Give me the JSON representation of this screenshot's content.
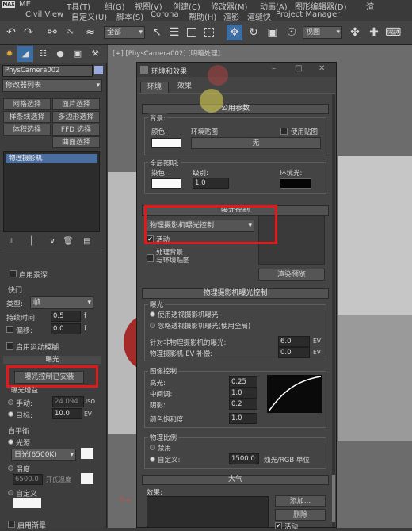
{
  "app": {
    "logo": "MAX"
  },
  "menubar": {
    "row1": [
      "ME",
      "T具(T)",
      "组(G)",
      "视图(V)",
      "创建(C)",
      "修改器(M)",
      "动画(A)",
      "图形编辑器(D)",
      "渲"
    ],
    "row2": [
      "Civil View",
      "自定义(U)",
      "脚本(S)",
      "Corona",
      "帮助(H)",
      "渲影",
      "渲缝快",
      "Project Manager"
    ]
  },
  "toolbar": {
    "selection_filter": "全部",
    "view_dropdown": "视图",
    "undo_icon": "undo-icon",
    "redo_icon": "redo-icon"
  },
  "left_panel": {
    "object_name": "PhysCamera002",
    "modifier_list": "修改器列表",
    "buttons": [
      "网格选择",
      "面片选择",
      "样条线选择",
      "多边形选择",
      "体积选择",
      "FFD 选择",
      "",
      "曲面选择"
    ],
    "stack_item": "物理摄影机",
    "enable_dof": "启用景深",
    "shutter": {
      "title": "快门",
      "type_label": "类型:",
      "type_value": "帧",
      "duration_label": "持续时间:",
      "duration_value": "0.5",
      "duration_unit": "f",
      "offset_label": "偏移:",
      "offset_value": "0.0",
      "offset_unit": "f",
      "motion_blur": "启用运动模糊"
    },
    "exposure": {
      "title": "曝光",
      "installed_btn": "曝光控制已安装",
      "gain_label": "曝光增益",
      "manual": "手动:",
      "manual_value": "24.094",
      "manual_unit": "ISO",
      "target": "目标:",
      "target_value": "10.0",
      "target_unit": "EV"
    },
    "white_balance": {
      "title": "白平衡",
      "light_source": "光源",
      "daylight": "日光(6500K)",
      "temperature": "温度",
      "temp_value": "6500.0",
      "temp_unit": "开氏温度",
      "custom": "自定义",
      "vignette": "启用渐晕"
    }
  },
  "viewport": {
    "label": "[+] [PhysCamera002] [明暗处理]"
  },
  "dialog": {
    "title": "环境和效果",
    "tabs": [
      "环境",
      "效果"
    ],
    "common_params": {
      "header": "公用参数",
      "background": "背景:",
      "color_label": "颜色:",
      "env_map_label": "环境贴图:",
      "use_map": "使用贴图",
      "map_value": "无",
      "global_lighting": "全局照明:",
      "tint_label": "染色:",
      "level_label": "级别:",
      "level_value": "1.0",
      "ambient_label": "环境光:"
    },
    "exposure_control": {
      "header": "曝光控制",
      "dropdown": "物理摄影机曝光控制",
      "active": "活动",
      "process_bg": "处理背景",
      "env_map": "与环境贴图",
      "render_preview": "渲染预览"
    },
    "physcam_exposure": {
      "header": "物理摄影机曝光控制",
      "exposure_title": "曝光",
      "use_physcam": "使用透视摄影机曝光",
      "ignore_physcam": "忽略透视摄影机曝光(使用全局)",
      "nonphys_label": "针对非物理摄影机的曝光:",
      "nonphys_value": "6.0",
      "nonphys_unit": "EV",
      "comp_label": "物理摄影机 EV 补偿:",
      "comp_value": "0.0",
      "comp_unit": "EV",
      "image_control": "图像控制",
      "highlights": "高光:",
      "highlights_value": "0.25",
      "midtones": "中间调:",
      "midtones_value": "1.0",
      "shadows": "阴影:",
      "shadows_value": "0.2",
      "saturation": "颜色饱和度",
      "saturation_value": "1.0",
      "scale_title": "物理比例",
      "disable": "禁用",
      "custom": "自定义:",
      "custom_value": "1500.0",
      "custom_unit": "烛光/RGB 单位"
    },
    "atmosphere": {
      "header": "大气",
      "effects_label": "效果:",
      "add_btn": "添加...",
      "delete_btn": "删除",
      "active": "活动"
    }
  }
}
